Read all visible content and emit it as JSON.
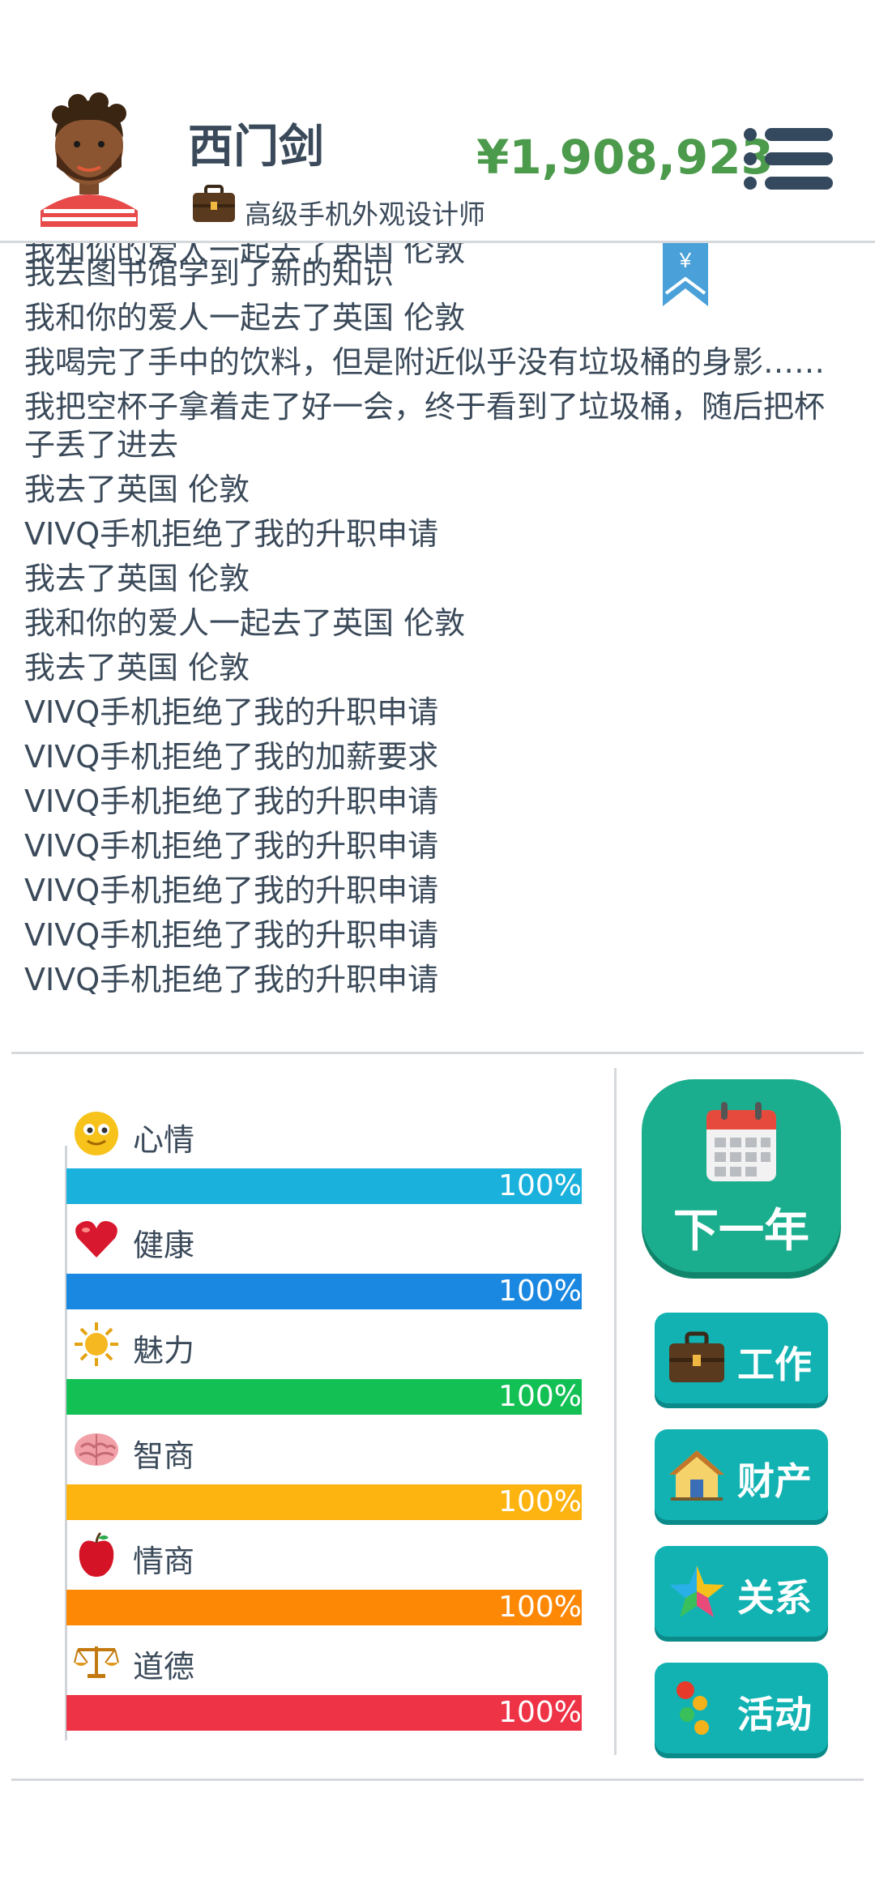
{
  "header": {
    "player_name": "西门剑",
    "job_title": "高级手机外观设计师",
    "money": "¥1,908,923"
  },
  "log": {
    "cut_line": "我和你的爱人一起去了英国 伦敦",
    "items": [
      "我去图书馆学到了新的知识",
      "我和你的爱人一起去了英国 伦敦",
      "我喝完了手中的饮料，但是附近似乎没有垃圾桶的身影……",
      "我把空杯子拿着走了好一会，终于看到了垃圾桶，随后把杯子丢了进去",
      "我去了英国 伦敦",
      "VIVQ手机拒绝了我的升职申请",
      "我去了英国 伦敦",
      "我和你的爱人一起去了英国 伦敦",
      "我去了英国 伦敦",
      "VIVQ手机拒绝了我的升职申请",
      "VIVQ手机拒绝了我的加薪要求",
      "VIVQ手机拒绝了我的升职申请",
      "VIVQ手机拒绝了我的升职申请",
      "VIVQ手机拒绝了我的升职申请",
      "VIVQ手机拒绝了我的升职申请",
      "VIVQ手机拒绝了我的升职申请"
    ],
    "bookmark_symbol": "¥"
  },
  "stats": [
    {
      "label": "心情",
      "value": "100%",
      "fraction": 1.0,
      "color": "#1ab1dd",
      "icon": "smiley-icon"
    },
    {
      "label": "健康",
      "value": "100%",
      "fraction": 1.0,
      "color": "#1a88e0",
      "icon": "heart-icon"
    },
    {
      "label": "魅力",
      "value": "100%",
      "fraction": 1.0,
      "color": "#12c054",
      "icon": "sun-icon"
    },
    {
      "label": "智商",
      "value": "100%",
      "fraction": 1.0,
      "color": "#fdb310",
      "icon": "brain-icon"
    },
    {
      "label": "情商",
      "value": "100%",
      "fraction": 1.0,
      "color": "#fd8806",
      "icon": "apple-icon"
    },
    {
      "label": "道德",
      "value": "100%",
      "fraction": 1.0,
      "color": "#ef3346",
      "icon": "scales-icon"
    }
  ],
  "actions": {
    "next_year": "下一年",
    "work": "工作",
    "property": "财产",
    "relations": "关系",
    "activities": "活动"
  },
  "colors": {
    "money": "#4c9a4c",
    "text": "#3b4a5a",
    "next_year_button": "#1bae8e",
    "action_button": "#12b2b2"
  }
}
